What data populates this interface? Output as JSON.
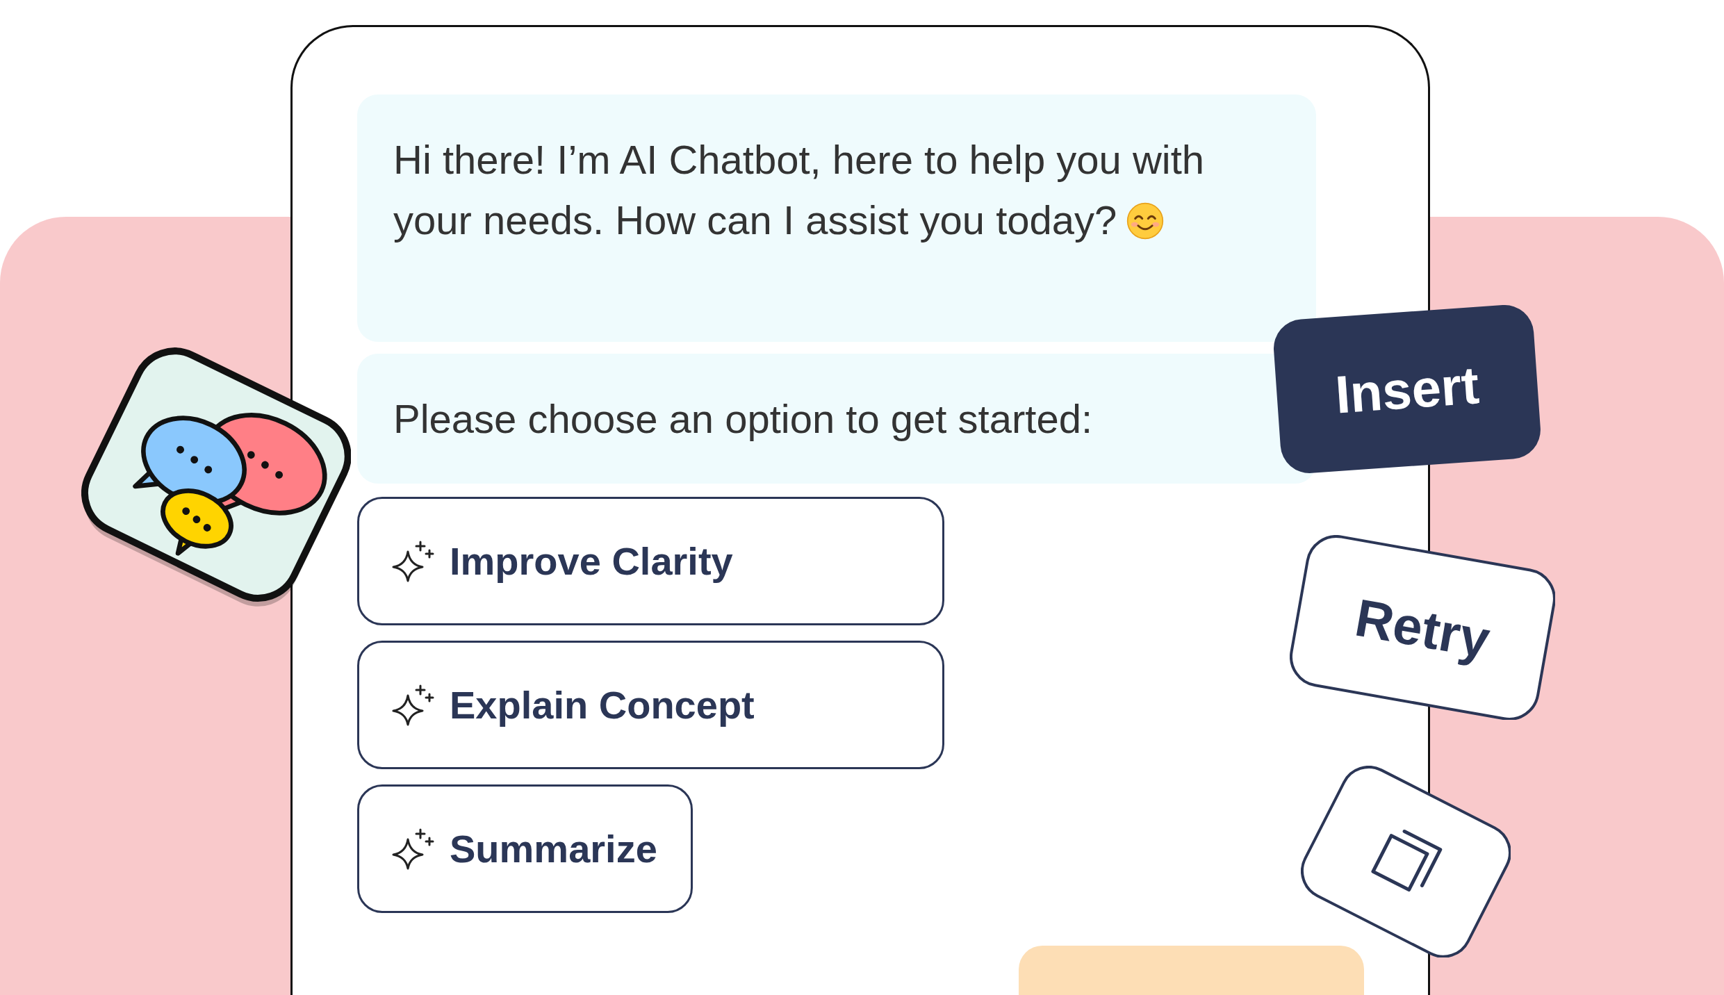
{
  "greeting": {
    "text": "Hi there! I’m AI Chatbot, here to help you with your needs. How can I assist you today?",
    "emoji": true
  },
  "prompt": {
    "text": "Please choose an option to get started:"
  },
  "options": [
    {
      "label": "Improve Clarity"
    },
    {
      "label": "Explain Concept"
    },
    {
      "label": "Summarize"
    }
  ],
  "actions": [
    {
      "kind": "primary",
      "label": "Insert"
    },
    {
      "kind": "outline",
      "label": "Retry"
    },
    {
      "kind": "icon"
    }
  ]
}
